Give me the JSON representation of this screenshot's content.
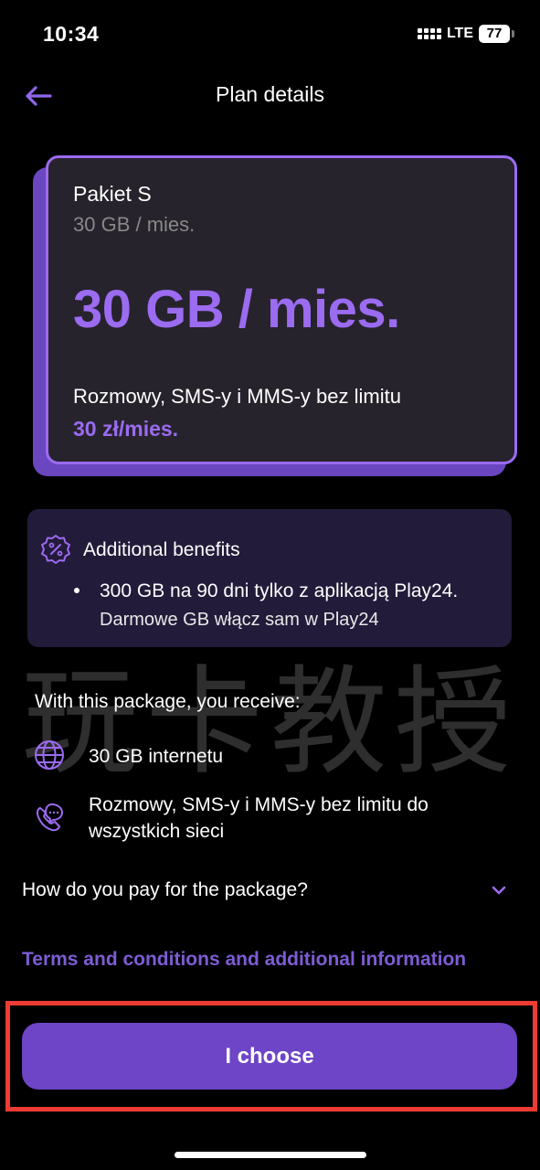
{
  "status_bar": {
    "time": "10:34",
    "network": "LTE",
    "battery": "77"
  },
  "header": {
    "title": "Plan details",
    "back_icon": "arrow-left-icon"
  },
  "plan": {
    "name": "Pakiet S",
    "subtitle": "30 GB / mies.",
    "headline": "30 GB / mies.",
    "description": "Rozmowy, SMS-y i MMS-y bez limitu",
    "price": "30 zł/mies."
  },
  "benefits": {
    "icon": "percent-badge-icon",
    "title": "Additional benefits",
    "items": [
      {
        "line1": "300 GB na 90 dni tylko z aplikacją Play24.",
        "line2": "Darmowe GB włącz sam w Play24"
      }
    ]
  },
  "watermark": "玩卡教授",
  "receive": {
    "title": "With this package, you receive:",
    "features": [
      {
        "icon": "globe-icon",
        "lines": [
          "30 GB internetu"
        ]
      },
      {
        "icon": "phone-chat-icon",
        "lines": [
          "Rozmowy, SMS-y i MMS-y bez limitu do",
          "wszystkich sieci"
        ]
      }
    ]
  },
  "payment_accordion": {
    "label": "How do you pay for the package?",
    "icon": "chevron-down-icon"
  },
  "terms_link": "Terms and conditions and additional information",
  "cta": {
    "label": "I choose"
  },
  "colors": {
    "accent": "#9b6bf0",
    "button": "#6d45c6",
    "card_bg": "#26232c",
    "benefits_bg": "#231b3a",
    "highlight_border": "#ee3b34",
    "background": "#000000"
  }
}
